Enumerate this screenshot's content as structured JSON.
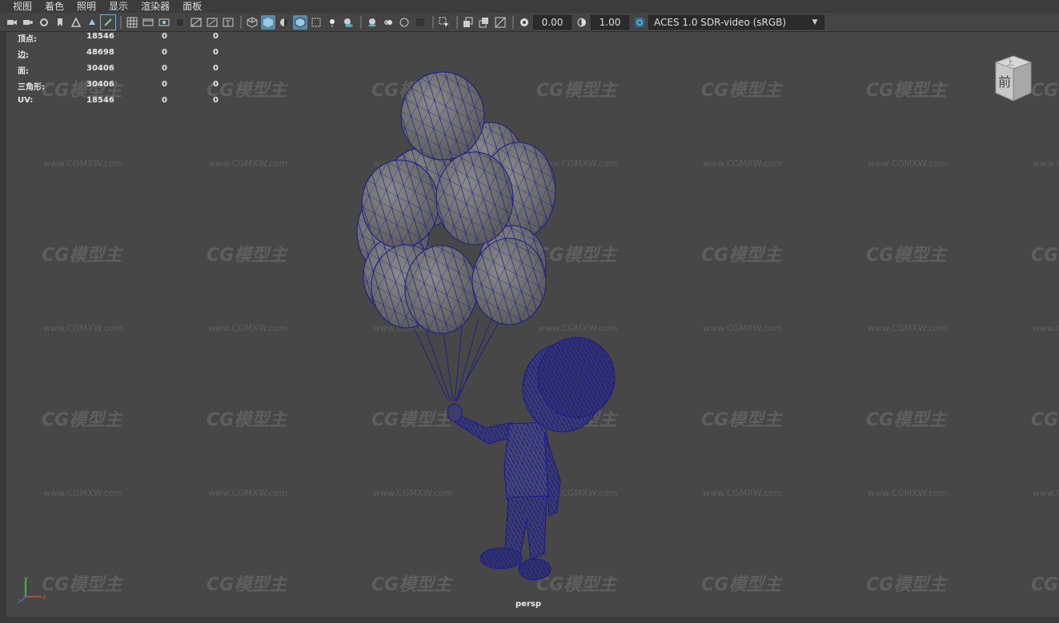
{
  "menu": [
    "视图",
    "着色",
    "照明",
    "显示",
    "渲染器",
    "面板"
  ],
  "toolbar": {
    "exposure_value": "0.00",
    "gamma_value": "1.00",
    "color_space": "ACES 1.0 SDR-video (sRGB)",
    "icons": [
      "camera-select-icon",
      "camera-attr-icon",
      "bookmark-icon",
      "image-plane-icon",
      "grid-icon",
      "film-gate-icon",
      "resolution-gate-icon",
      "gate-mask-icon",
      "field-chart-icon",
      "safe-action-icon",
      "safe-title-icon",
      "wireframe-icon",
      "smooth-shade-icon",
      "textured-icon",
      "wireframe-on-shaded-icon",
      "xray-icon",
      "lights-icon",
      "shadows-icon",
      "ambient-occlusion-icon",
      "motion-blur-icon",
      "anti-alias-icon",
      "depth-of-field-icon",
      "isolate-select-icon",
      "xray-joints-icon",
      "xray-active-icon",
      "backface-icon",
      "exposure-icon",
      "gamma-icon",
      "color-mgmt-icon"
    ]
  },
  "hud": {
    "rows": [
      {
        "label": "顶点:",
        "v1": "18546",
        "v2": "0",
        "v3": "0"
      },
      {
        "label": "边:",
        "v1": "48698",
        "v2": "0",
        "v3": "0"
      },
      {
        "label": "面:",
        "v1": "30406",
        "v2": "0",
        "v3": "0"
      },
      {
        "label": "三角形:",
        "v1": "30406",
        "v2": "0",
        "v3": "0"
      },
      {
        "label": "UV:",
        "v1": "18546",
        "v2": "0",
        "v3": "0"
      }
    ]
  },
  "viewcube": {
    "front_label": "前",
    "top_label": "上"
  },
  "camera_label": "persp",
  "axis": {
    "y": "y",
    "x": "x",
    "z": "z"
  },
  "watermark": {
    "logo": "CG模型主",
    "url": "www.CGMXW.com"
  },
  "colors": {
    "wireframe": "#1a1a8c",
    "viewport_bg": "#474747",
    "highlight": "#5a8aa8"
  }
}
